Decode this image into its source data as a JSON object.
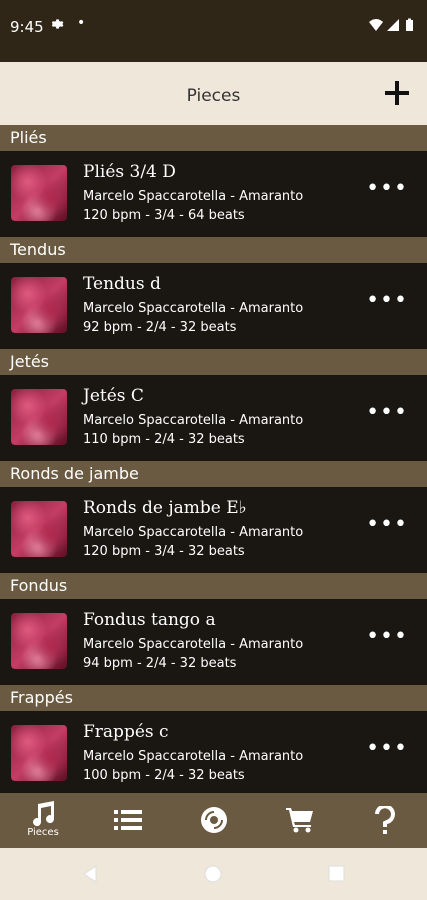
{
  "status": {
    "time": "9:45",
    "dot": "•"
  },
  "appbar": {
    "title": "Pieces"
  },
  "pieces": [
    {
      "section": "Pliés",
      "name": "Pliés 3/4 D",
      "artist": "Marcelo Spaccarotella - Amaranto",
      "meta": "120 bpm - 3/4 - 64 beats"
    },
    {
      "section": "Tendus",
      "name": "Tendus d",
      "artist": "Marcelo Spaccarotella - Amaranto",
      "meta": "92 bpm - 2/4 - 32 beats"
    },
    {
      "section": "Jetés",
      "name": "Jetés C",
      "artist": "Marcelo Spaccarotella - Amaranto",
      "meta": "110 bpm - 2/4 - 32 beats"
    },
    {
      "section": "Ronds de jambe",
      "name": "Ronds de jambe E♭",
      "artist": "Marcelo Spaccarotella - Amaranto",
      "meta": "120 bpm - 3/4 - 32 beats"
    },
    {
      "section": "Fondus",
      "name": "Fondus tango a",
      "artist": "Marcelo Spaccarotella - Amaranto",
      "meta": "94 bpm - 2/4 - 32 beats"
    },
    {
      "section": "Frappés",
      "name": "Frappés c",
      "artist": "Marcelo Spaccarotella - Amaranto",
      "meta": "100 bpm - 2/4 - 32 beats"
    }
  ],
  "more_label": "•••",
  "nav": {
    "pieces_label": "Pieces"
  },
  "icons": [
    "settings-icon",
    "wifi-icon",
    "signal-icon",
    "battery-icon",
    "add-icon",
    "music-note-icon",
    "list-icon",
    "disc-icon",
    "cart-icon",
    "help-icon",
    "back-icon",
    "home-icon",
    "recents-icon"
  ],
  "colors": {
    "status_bar": "#2f2618",
    "header": "#6a5a42",
    "row": "#1a1612",
    "appbar": "#f0e7db"
  }
}
